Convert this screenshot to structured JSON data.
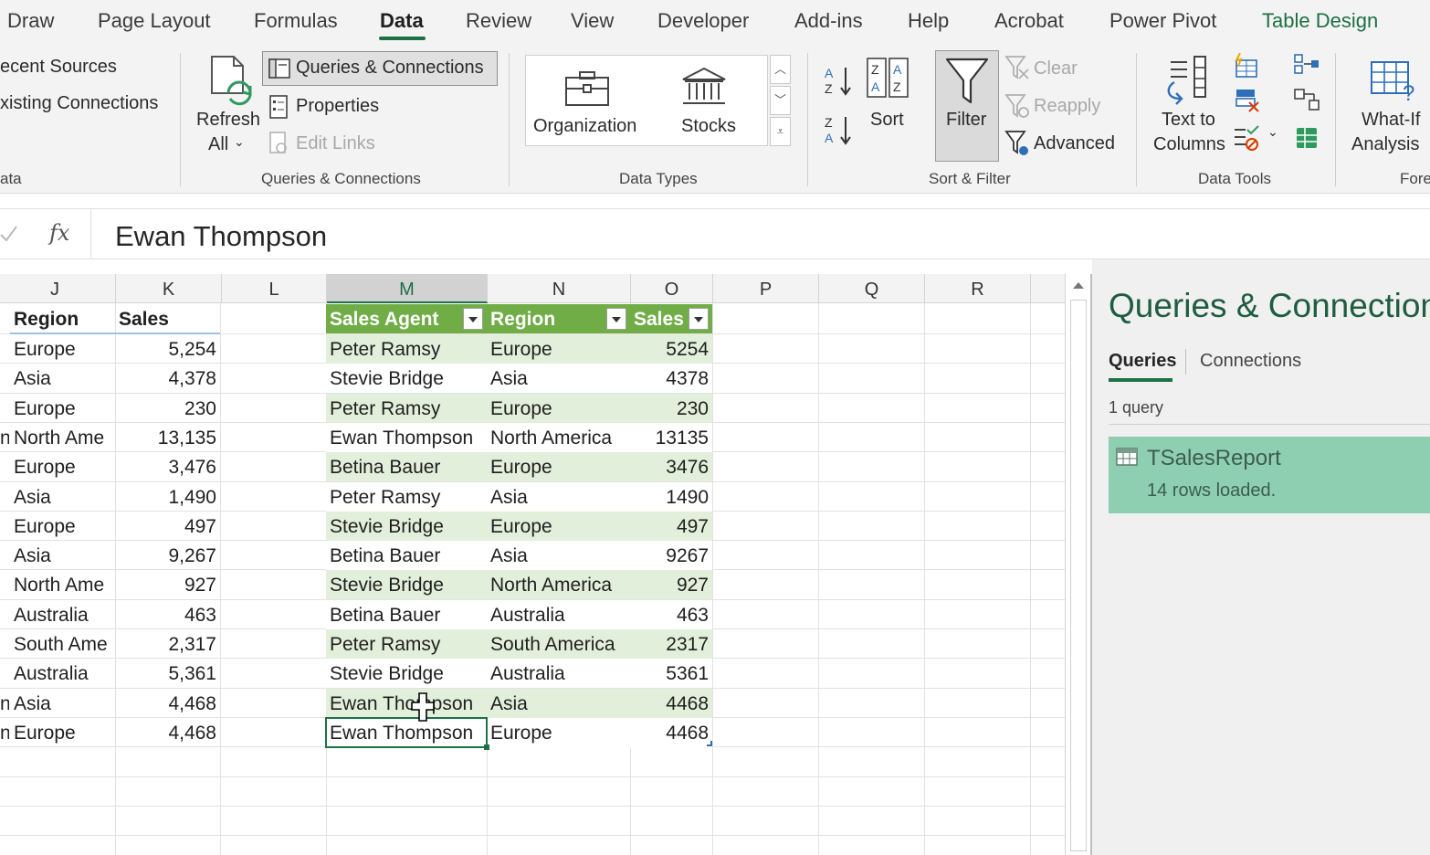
{
  "menu": {
    "tabs": [
      {
        "label": "Draw"
      },
      {
        "label": "Page Layout"
      },
      {
        "label": "Formulas"
      },
      {
        "label": "Data"
      },
      {
        "label": "Review"
      },
      {
        "label": "View"
      },
      {
        "label": "Developer"
      },
      {
        "label": "Add-ins"
      },
      {
        "label": "Help"
      },
      {
        "label": "Acrobat"
      },
      {
        "label": "Power Pivot"
      },
      {
        "label": "Table Design"
      }
    ],
    "active_tab": "Data"
  },
  "ribbon": {
    "get_data": {
      "recent_sources": "ecent Sources",
      "existing_connections": "xisting Connections",
      "group_label": "ata"
    },
    "queries": {
      "refresh_line1": "Refresh",
      "refresh_line2": "All",
      "queries_connections": "Queries & Connections",
      "properties": "Properties",
      "edit_links": "Edit Links",
      "group_label": "Queries & Connections"
    },
    "data_types": {
      "organization": "Organization",
      "stocks": "Stocks",
      "group_label": "Data Types"
    },
    "sort_filter": {
      "sort": "Sort",
      "filter": "Filter",
      "clear": "Clear",
      "reapply": "Reapply",
      "advanced": "Advanced",
      "group_label": "Sort & Filter"
    },
    "data_tools": {
      "text_to_line1": "Text to",
      "text_to_line2": "Columns",
      "group_label": "Data Tools"
    },
    "forecast": {
      "whatif_line1": "What-If",
      "whatif_line2": "Analysis",
      "group_label": "Fore"
    }
  },
  "formula_bar": {
    "fx": "fx",
    "value": "Ewan Thompson"
  },
  "grid": {
    "columns": [
      "J",
      "K",
      "L",
      "M",
      "N",
      "O",
      "P",
      "Q",
      "R"
    ],
    "selected_column": "M",
    "left_table": {
      "headers": [
        "Region",
        "Sales"
      ],
      "rows": [
        {
          "prefix": "",
          "region": "Europe",
          "sales": "5,254"
        },
        {
          "prefix": "",
          "region": "Asia",
          "sales": "4,378"
        },
        {
          "prefix": "",
          "region": "Europe",
          "sales": "230"
        },
        {
          "prefix": "n",
          "region": "North Ame",
          "sales": "13,135"
        },
        {
          "prefix": "",
          "region": "Europe",
          "sales": "3,476"
        },
        {
          "prefix": "",
          "region": "Asia",
          "sales": "1,490"
        },
        {
          "prefix": "",
          "region": "Europe",
          "sales": "497"
        },
        {
          "prefix": "",
          "region": "Asia",
          "sales": "9,267"
        },
        {
          "prefix": "",
          "region": "North Ame",
          "sales": "927"
        },
        {
          "prefix": "",
          "region": "Australia",
          "sales": "463"
        },
        {
          "prefix": "",
          "region": "South Ame",
          "sales": "2,317"
        },
        {
          "prefix": "",
          "region": "Australia",
          "sales": "5,361"
        },
        {
          "prefix": "n",
          "region": "Asia",
          "sales": "4,468"
        },
        {
          "prefix": "n",
          "region": "Europe",
          "sales": "4,468"
        }
      ]
    },
    "query_table": {
      "headers": [
        "Sales Agent",
        "Region",
        "Sales"
      ],
      "rows": [
        [
          "Peter Ramsy",
          "Europe",
          "5254"
        ],
        [
          "Stevie Bridge",
          "Asia",
          "4378"
        ],
        [
          "Peter Ramsy",
          "Europe",
          "230"
        ],
        [
          "Ewan Thompson",
          "North America",
          "13135"
        ],
        [
          "Betina Bauer",
          "Europe",
          "3476"
        ],
        [
          "Peter Ramsy",
          "Asia",
          "1490"
        ],
        [
          "Stevie Bridge",
          "Europe",
          "497"
        ],
        [
          "Betina Bauer",
          "Asia",
          "9267"
        ],
        [
          "Stevie Bridge",
          "North America",
          "927"
        ],
        [
          "Betina Bauer",
          "Australia",
          "463"
        ],
        [
          "Peter Ramsy",
          "South America",
          "2317"
        ],
        [
          "Stevie Bridge",
          "Australia",
          "5361"
        ],
        [
          "Ewan Thompson",
          "Asia",
          "4468"
        ],
        [
          "Ewan Thompson",
          "Europe",
          "4468"
        ]
      ]
    }
  },
  "queries_pane": {
    "title": "Queries & Connections",
    "tabs": [
      "Queries",
      "Connections"
    ],
    "count": "1 query",
    "items": [
      {
        "name": "TSalesReport",
        "status": "14 rows loaded."
      }
    ]
  },
  "colors": {
    "accent": "#217346",
    "table_header": "#70ad47",
    "band_light": "#e2efda",
    "query_item": "#8fcfb1"
  }
}
